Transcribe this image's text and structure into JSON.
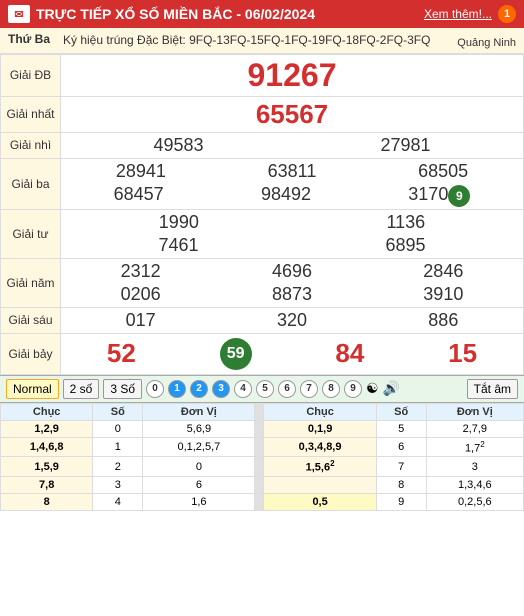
{
  "header": {
    "icon": "✉",
    "title": "TRỰC TIẾP XỔ SỐ MIỀN BẮC - 06/02/2024",
    "link": "Xem thêm!...",
    "notification": "1"
  },
  "date_row": {
    "label": "Thứ Ba",
    "codes": "Ký hiệu trúng Đặc Biệt: 9FQ-13FQ-15FQ-1FQ-19FQ-18FQ-2FQ-3FQ",
    "province": "Quảng Ninh"
  },
  "prizes": {
    "db_label": "Giải ĐB",
    "db_value": "91267",
    "nhat_label": "Giải nhất",
    "nhat_value": "65567",
    "nhi_label": "Giải nhì",
    "nhi_values": [
      "49583",
      "27981"
    ],
    "ba_label": "Giải ba",
    "ba_values": [
      "28941",
      "63811",
      "68505",
      "68457",
      "98492",
      "3170",
      "9"
    ],
    "tu_label": "Giải tư",
    "tu_values": [
      "1990",
      "1136",
      "7461",
      "6895"
    ],
    "nam_label": "Giải năm",
    "nam_values": [
      "2312",
      "4696",
      "2846",
      "0206",
      "8873",
      "3910"
    ],
    "sau_label": "Giải sáu",
    "sau_values": [
      "017",
      "320",
      "886"
    ],
    "bay_label": "Giải bảy",
    "bay_values": [
      "52",
      "59",
      "84",
      "15"
    ]
  },
  "toolbar": {
    "normal": "Normal",
    "2so": "2 số",
    "3so": "3 Số",
    "digits": [
      "0",
      "1",
      "2",
      "3",
      "4",
      "5",
      "6",
      "7",
      "8",
      "9"
    ],
    "yin_yang": "☯",
    "speaker": "🔊",
    "tat_am": "Tắt âm"
  },
  "analysis": {
    "headers_left": [
      "Chục",
      "Số",
      "Đơn Vị"
    ],
    "headers_right": [
      "Chục",
      "Số",
      "Đơn Vị"
    ],
    "rows": [
      {
        "chuc_l": "1,2,9",
        "so_l": "0",
        "dv_l": "5,6,9",
        "chuc_r": "0,1,9",
        "so_r": "5",
        "dv_r": "2,7,9"
      },
      {
        "chuc_l": "1,4,6,8",
        "so_l": "1",
        "dv_l": "0,1,2,5,7",
        "chuc_r": "0,3,4,8,9",
        "so_r": "6",
        "dv_r": "1,7",
        "dv_r_sup": "2"
      },
      {
        "chuc_l": "1,5,9",
        "so_l": "2",
        "dv_l": "0",
        "chuc_r": "1,5,6",
        "dv_r_sup2": "2",
        "so_r": "7",
        "dv_r": "3"
      },
      {
        "chuc_l": "7,8",
        "so_l": "3",
        "dv_l": "6",
        "chuc_r": "",
        "so_r": "8",
        "dv_r": "1,3,4,6"
      },
      {
        "chuc_l": "8",
        "so_l": "4",
        "dv_l": "1,6",
        "chuc_r": "0,5",
        "so_r_hl": true,
        "so_r": "9",
        "dv_r": "0,2,5,6"
      }
    ]
  }
}
